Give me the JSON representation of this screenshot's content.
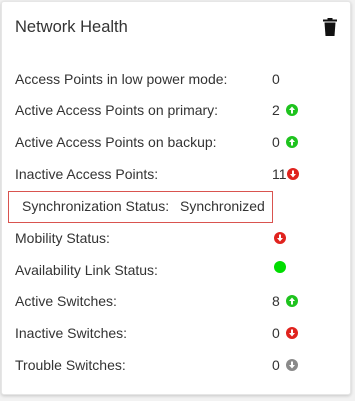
{
  "title": "Network Health",
  "icons": {
    "delete": "trash-icon",
    "up": "arrow-up-circle-icon",
    "down": "arrow-down-circle-icon",
    "status": "status-dot-icon"
  },
  "colors": {
    "green": "#1ec31e",
    "red": "#e0231e",
    "gray": "#8a8a8a",
    "highlight": "#d9534f"
  },
  "rows": [
    {
      "label": "Access Points in low power mode:",
      "value": "0",
      "indicator": "none"
    },
    {
      "label": "Active Access Points on primary:",
      "value": "2",
      "indicator": "up-green"
    },
    {
      "label": "Active Access Points on backup:",
      "value": "0",
      "indicator": "up-green"
    },
    {
      "label": "Inactive Access Points:",
      "value": "11",
      "indicator": "down-red"
    },
    {
      "label": "Mobility Status:",
      "value": "",
      "indicator": "down-red"
    },
    {
      "label": "Availability Link Status:",
      "value": "",
      "indicator": "dot-green"
    },
    {
      "label": "Active Switches:",
      "value": "8",
      "indicator": "up-green"
    },
    {
      "label": "Inactive Switches:",
      "value": "0",
      "indicator": "down-red"
    },
    {
      "label": "Trouble Switches:",
      "value": "0",
      "indicator": "down-gray"
    }
  ],
  "sync": {
    "label": "Synchronization Status:",
    "value": "Synchronized"
  }
}
